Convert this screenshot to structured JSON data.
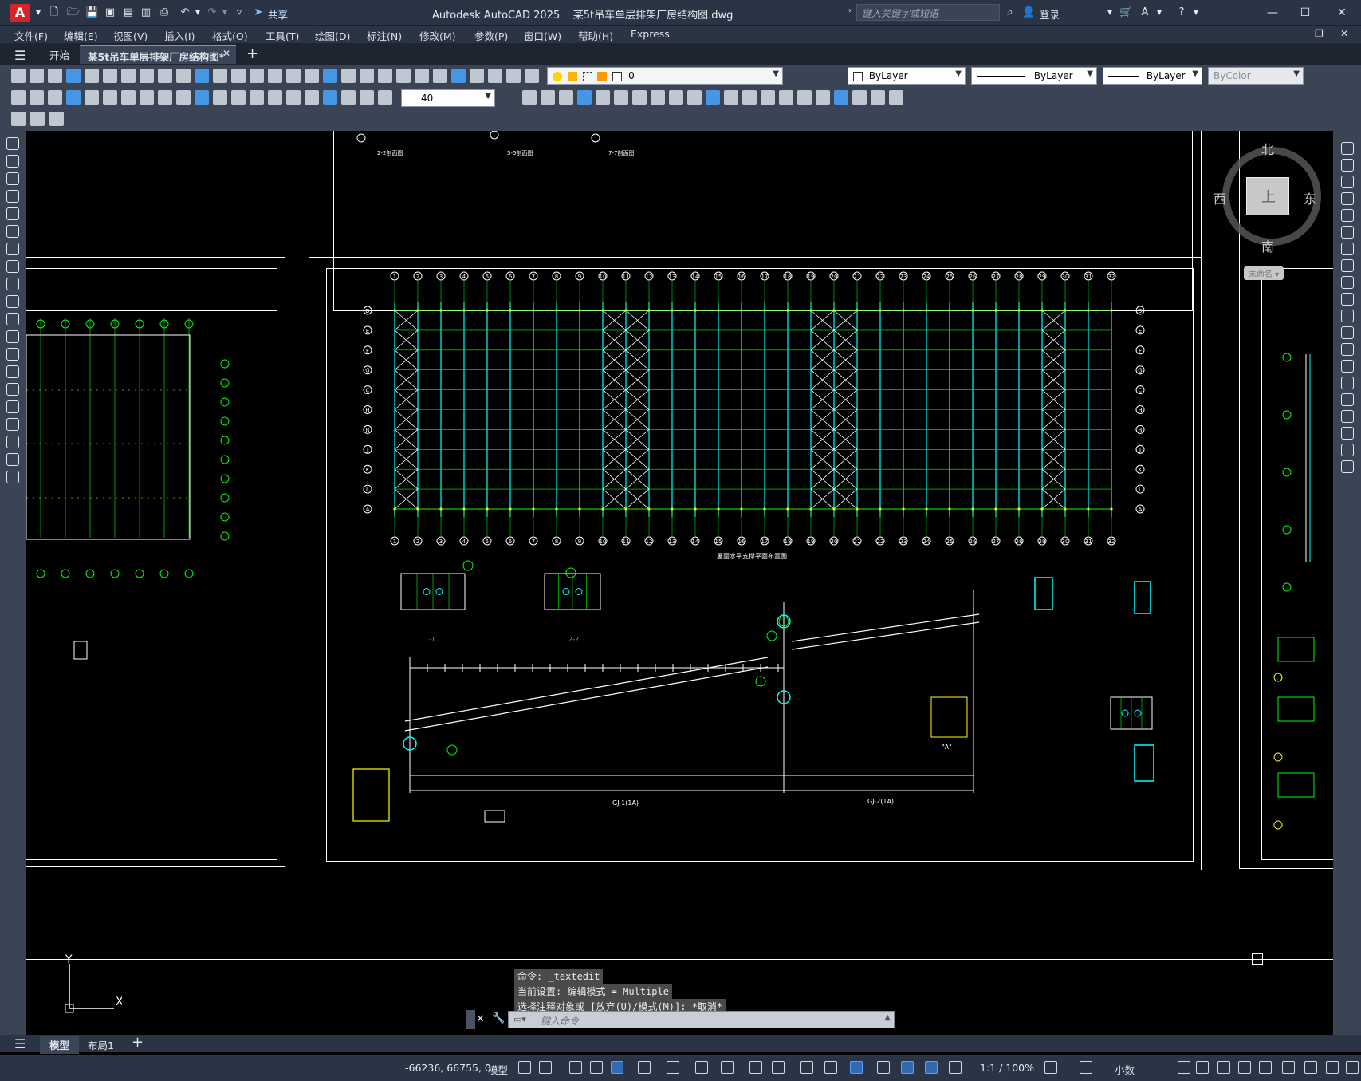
{
  "app": {
    "title": "Autodesk AutoCAD 2025    某5t吊车单层排架厂房结构图.dwg",
    "share_label": "共享",
    "search_placeholder": "键入关键字或短语",
    "login_label": "登录"
  },
  "menu": [
    "文件(F)",
    "编辑(E)",
    "视图(V)",
    "插入(I)",
    "格式(O)",
    "工具(T)",
    "绘图(D)",
    "标注(N)",
    "修改(M)",
    "参数(P)",
    "窗口(W)",
    "帮助(H)",
    "Express"
  ],
  "tabs": {
    "start": "开始",
    "active": "某5t吊车单层排架厂房结构图*"
  },
  "properties": {
    "layer": "0",
    "color": "ByLayer",
    "linetype": "ByLayer",
    "lineweight": "ByLayer",
    "plotstyle": "ByColor",
    "text_height": "40"
  },
  "viewcube": {
    "north": "北",
    "south": "南",
    "east": "东",
    "west": "西",
    "top": "上",
    "wcs_label": "未命名"
  },
  "command": {
    "history": [
      "命令: _textedit",
      "当前设置: 编辑模式 = Multiple",
      "选择注释对象或 [放弃(U)/模式(M)]: *取消*"
    ],
    "placeholder": "键入命令"
  },
  "layouts": {
    "model": "模型",
    "layout1": "布局1"
  },
  "status": {
    "coords": "-66236, 66755, 0",
    "space": "模型",
    "scale": "1:1 / 100%",
    "units": "小数"
  },
  "drawing": {
    "grid_numbers_top": [
      "1",
      "2",
      "3",
      "4",
      "5",
      "6",
      "7",
      "8",
      "9",
      "10",
      "11",
      "12",
      "13",
      "14",
      "15",
      "16",
      "17",
      "18",
      "19",
      "20",
      "21",
      "22",
      "23",
      "24",
      "25",
      "26",
      "27",
      "28",
      "29",
      "30",
      "31",
      "32"
    ],
    "grid_letters_side": [
      "D",
      "E",
      "F",
      "G",
      "C",
      "H",
      "B",
      "J",
      "K",
      "L",
      "A"
    ],
    "captions": [
      "2-2剖面图",
      "5-5剖面图",
      "7-7剖面图",
      "屋面水平支撑平面布置图",
      "1-1",
      "2-2",
      "GJ-1(1A)",
      "GJ-2(1A)",
      "\"A\""
    ]
  },
  "colors": {
    "accent": "#4aa3ff",
    "logo": "#d8232a",
    "line_green": "#00ff00",
    "line_cyan": "#00ffff",
    "line_yellow": "#ffff00"
  }
}
